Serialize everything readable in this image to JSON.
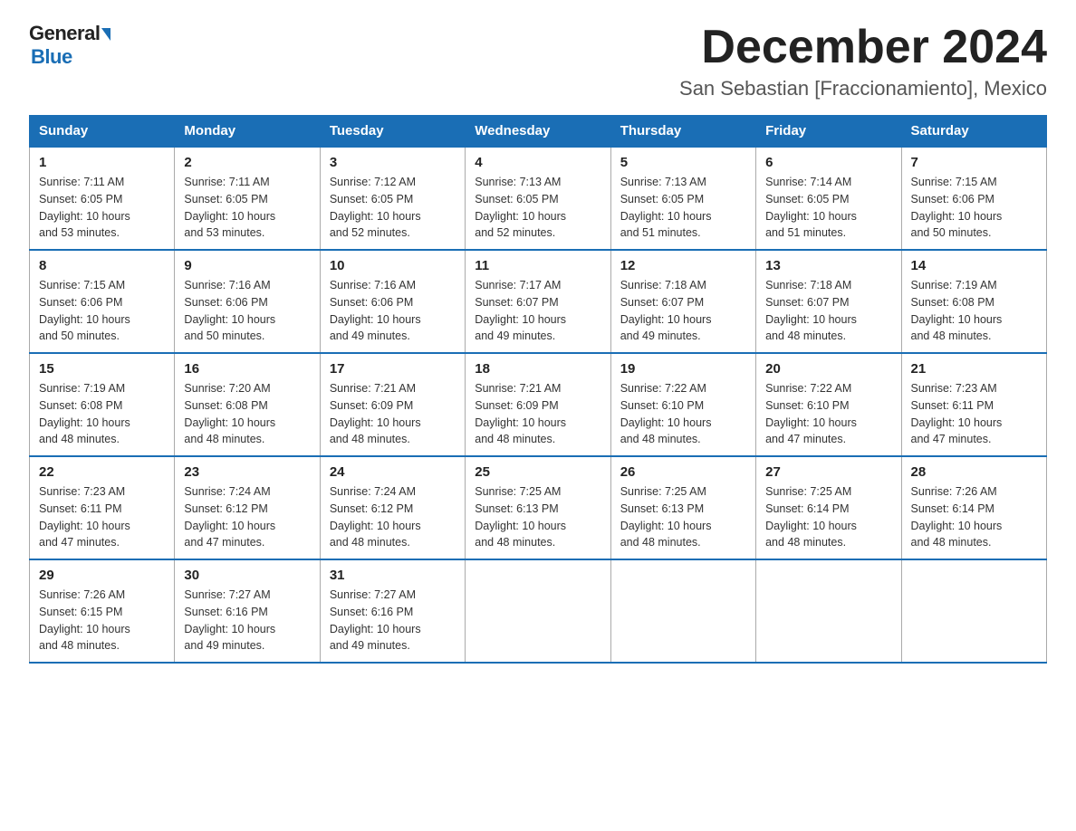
{
  "logo": {
    "part1": "General",
    "part2": "Blue"
  },
  "header": {
    "month_year": "December 2024",
    "location": "San Sebastian [Fraccionamiento], Mexico"
  },
  "days_of_week": [
    "Sunday",
    "Monday",
    "Tuesday",
    "Wednesday",
    "Thursday",
    "Friday",
    "Saturday"
  ],
  "weeks": [
    [
      {
        "day": "1",
        "sunrise": "7:11 AM",
        "sunset": "6:05 PM",
        "daylight": "10 hours and 53 minutes."
      },
      {
        "day": "2",
        "sunrise": "7:11 AM",
        "sunset": "6:05 PM",
        "daylight": "10 hours and 53 minutes."
      },
      {
        "day": "3",
        "sunrise": "7:12 AM",
        "sunset": "6:05 PM",
        "daylight": "10 hours and 52 minutes."
      },
      {
        "day": "4",
        "sunrise": "7:13 AM",
        "sunset": "6:05 PM",
        "daylight": "10 hours and 52 minutes."
      },
      {
        "day": "5",
        "sunrise": "7:13 AM",
        "sunset": "6:05 PM",
        "daylight": "10 hours and 51 minutes."
      },
      {
        "day": "6",
        "sunrise": "7:14 AM",
        "sunset": "6:05 PM",
        "daylight": "10 hours and 51 minutes."
      },
      {
        "day": "7",
        "sunrise": "7:15 AM",
        "sunset": "6:06 PM",
        "daylight": "10 hours and 50 minutes."
      }
    ],
    [
      {
        "day": "8",
        "sunrise": "7:15 AM",
        "sunset": "6:06 PM",
        "daylight": "10 hours and 50 minutes."
      },
      {
        "day": "9",
        "sunrise": "7:16 AM",
        "sunset": "6:06 PM",
        "daylight": "10 hours and 50 minutes."
      },
      {
        "day": "10",
        "sunrise": "7:16 AM",
        "sunset": "6:06 PM",
        "daylight": "10 hours and 49 minutes."
      },
      {
        "day": "11",
        "sunrise": "7:17 AM",
        "sunset": "6:07 PM",
        "daylight": "10 hours and 49 minutes."
      },
      {
        "day": "12",
        "sunrise": "7:18 AM",
        "sunset": "6:07 PM",
        "daylight": "10 hours and 49 minutes."
      },
      {
        "day": "13",
        "sunrise": "7:18 AM",
        "sunset": "6:07 PM",
        "daylight": "10 hours and 48 minutes."
      },
      {
        "day": "14",
        "sunrise": "7:19 AM",
        "sunset": "6:08 PM",
        "daylight": "10 hours and 48 minutes."
      }
    ],
    [
      {
        "day": "15",
        "sunrise": "7:19 AM",
        "sunset": "6:08 PM",
        "daylight": "10 hours and 48 minutes."
      },
      {
        "day": "16",
        "sunrise": "7:20 AM",
        "sunset": "6:08 PM",
        "daylight": "10 hours and 48 minutes."
      },
      {
        "day": "17",
        "sunrise": "7:21 AM",
        "sunset": "6:09 PM",
        "daylight": "10 hours and 48 minutes."
      },
      {
        "day": "18",
        "sunrise": "7:21 AM",
        "sunset": "6:09 PM",
        "daylight": "10 hours and 48 minutes."
      },
      {
        "day": "19",
        "sunrise": "7:22 AM",
        "sunset": "6:10 PM",
        "daylight": "10 hours and 48 minutes."
      },
      {
        "day": "20",
        "sunrise": "7:22 AM",
        "sunset": "6:10 PM",
        "daylight": "10 hours and 47 minutes."
      },
      {
        "day": "21",
        "sunrise": "7:23 AM",
        "sunset": "6:11 PM",
        "daylight": "10 hours and 47 minutes."
      }
    ],
    [
      {
        "day": "22",
        "sunrise": "7:23 AM",
        "sunset": "6:11 PM",
        "daylight": "10 hours and 47 minutes."
      },
      {
        "day": "23",
        "sunrise": "7:24 AM",
        "sunset": "6:12 PM",
        "daylight": "10 hours and 47 minutes."
      },
      {
        "day": "24",
        "sunrise": "7:24 AM",
        "sunset": "6:12 PM",
        "daylight": "10 hours and 48 minutes."
      },
      {
        "day": "25",
        "sunrise": "7:25 AM",
        "sunset": "6:13 PM",
        "daylight": "10 hours and 48 minutes."
      },
      {
        "day": "26",
        "sunrise": "7:25 AM",
        "sunset": "6:13 PM",
        "daylight": "10 hours and 48 minutes."
      },
      {
        "day": "27",
        "sunrise": "7:25 AM",
        "sunset": "6:14 PM",
        "daylight": "10 hours and 48 minutes."
      },
      {
        "day": "28",
        "sunrise": "7:26 AM",
        "sunset": "6:14 PM",
        "daylight": "10 hours and 48 minutes."
      }
    ],
    [
      {
        "day": "29",
        "sunrise": "7:26 AM",
        "sunset": "6:15 PM",
        "daylight": "10 hours and 48 minutes."
      },
      {
        "day": "30",
        "sunrise": "7:27 AM",
        "sunset": "6:16 PM",
        "daylight": "10 hours and 49 minutes."
      },
      {
        "day": "31",
        "sunrise": "7:27 AM",
        "sunset": "6:16 PM",
        "daylight": "10 hours and 49 minutes."
      },
      null,
      null,
      null,
      null
    ]
  ],
  "labels": {
    "sunrise": "Sunrise:",
    "sunset": "Sunset:",
    "daylight": "Daylight:"
  }
}
